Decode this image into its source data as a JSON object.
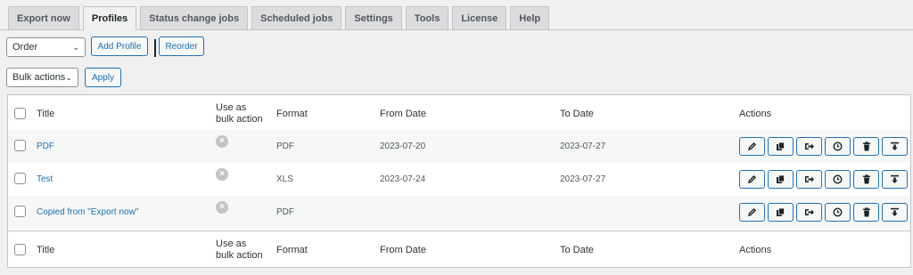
{
  "tabs": [
    {
      "label": "Export now",
      "active": false
    },
    {
      "label": "Profiles",
      "active": true
    },
    {
      "label": "Status change jobs",
      "active": false
    },
    {
      "label": "Scheduled jobs",
      "active": false
    },
    {
      "label": "Settings",
      "active": false
    },
    {
      "label": "Tools",
      "active": false
    },
    {
      "label": "License",
      "active": false
    },
    {
      "label": "Help",
      "active": false
    }
  ],
  "toolbar": {
    "order_select": "Order",
    "add_profile": "Add Profile",
    "reorder": "Reorder",
    "bulk_select": "Bulk actions",
    "apply": "Apply"
  },
  "table": {
    "columns": {
      "title": "Title",
      "use_bulk_1": "Use as",
      "use_bulk_2": "bulk action",
      "format": "Format",
      "from_date": "From Date",
      "to_date": "To Date",
      "actions": "Actions"
    },
    "rows": [
      {
        "title": "PDF",
        "format": "PDF",
        "from": "2023-07-20",
        "to": "2023-07-27"
      },
      {
        "title": "Test",
        "format": "XLS",
        "from": "2023-07-24",
        "to": "2023-07-27"
      },
      {
        "title": "Copied from \"Export now\"",
        "format": "PDF",
        "from": "",
        "to": ""
      }
    ]
  },
  "colors": {
    "accent": "#2271b1",
    "border": "#c3c4c7",
    "background": "#f0f0f1"
  },
  "icons": [
    "edit-icon",
    "copy-icon",
    "export-icon",
    "clock-icon",
    "trash-icon",
    "download-icon"
  ]
}
